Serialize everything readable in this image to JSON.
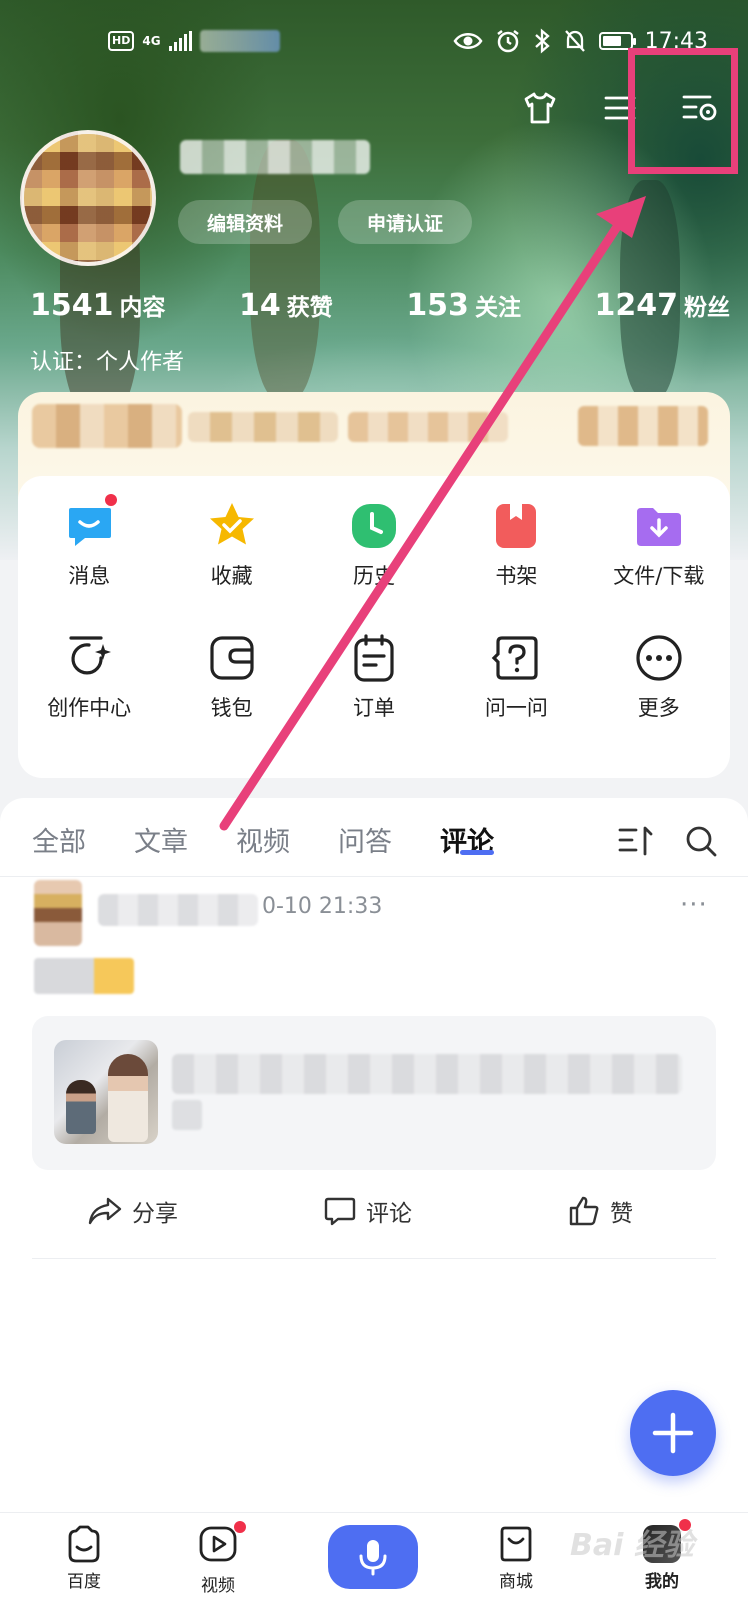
{
  "status_bar": {
    "hd_label": "HD",
    "network": "4G",
    "time": "17:43"
  },
  "header": {
    "icons": [
      "tshirt-icon",
      "menu-icon",
      "settings-icon"
    ]
  },
  "profile": {
    "edit_button": "编辑资料",
    "verify_button": "申请认证",
    "stats": [
      {
        "value": "1541",
        "label": "内容"
      },
      {
        "value": "14",
        "label": "获赞"
      },
      {
        "value": "153",
        "label": "关注"
      },
      {
        "value": "1247",
        "label": "粉丝"
      }
    ],
    "verification": "认证：个人作者"
  },
  "quick_menu": {
    "row1": [
      {
        "label": "消息",
        "icon": "message-icon",
        "color": "#2aa7f3",
        "badge": true
      },
      {
        "label": "收藏",
        "icon": "star-icon",
        "color": "#f6b800",
        "badge": false
      },
      {
        "label": "历史",
        "icon": "clock-icon",
        "color": "#2fbf71",
        "badge": false
      },
      {
        "label": "书架",
        "icon": "bookshelf-icon",
        "color": "#f25c5c",
        "badge": false
      },
      {
        "label": "文件/下载",
        "icon": "download-folder-icon",
        "color": "#a66cf0",
        "badge": false
      }
    ],
    "row2": [
      {
        "label": "创作中心",
        "icon": "creator-icon"
      },
      {
        "label": "钱包",
        "icon": "wallet-icon"
      },
      {
        "label": "订单",
        "icon": "order-icon"
      },
      {
        "label": "问一问",
        "icon": "ask-icon"
      },
      {
        "label": "更多",
        "icon": "more-icon"
      }
    ]
  },
  "tabs": {
    "items": [
      "全部",
      "文章",
      "视频",
      "问答",
      "评论"
    ],
    "active": "评论"
  },
  "post": {
    "time": "0-10 21:33",
    "more": "···",
    "actions": {
      "share": "分享",
      "comment": "评论",
      "like": "赞"
    }
  },
  "bottom_nav": {
    "home": "百度",
    "video": "视频",
    "mall": "商城",
    "mine": "我的"
  },
  "accent_color": "#4e6ef2",
  "annotation_color": "#e8407a",
  "watermark": "Bai 经验"
}
